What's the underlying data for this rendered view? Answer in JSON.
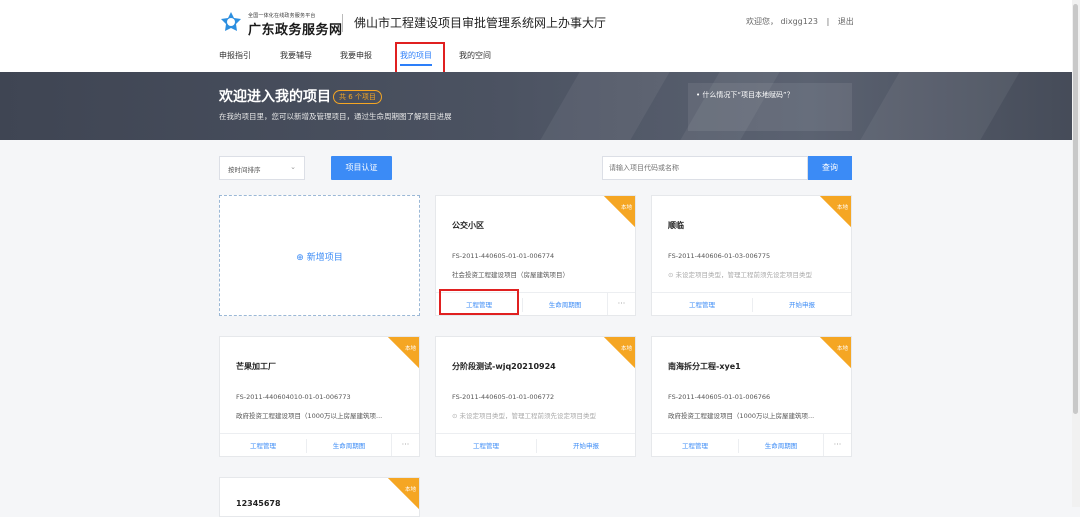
{
  "header": {
    "brand_small": "全国一体化在线政务服务平台",
    "brand_big": "广东政务服务网",
    "site_title": "佛山市工程建设项目审批管理系统网上办事大厅",
    "welcome": "欢迎您，  dixgg123",
    "separator": "|",
    "logout": "退出"
  },
  "nav": {
    "items": [
      {
        "label": "申报指引"
      },
      {
        "label": "我要辅导"
      },
      {
        "label": "我要申报"
      },
      {
        "label": "我的项目"
      },
      {
        "label": "我的空间"
      }
    ]
  },
  "banner": {
    "title": "欢迎进入我的项目",
    "badge": "共 6 个项目",
    "subtitle": "在我的项目里，您可以新增及管理项目，通过生命周期图了解项目进展",
    "help": "• 什么情况下“项目本地赋码”？"
  },
  "toolbar": {
    "sort_label": "按时间排序",
    "auth_button": "项目认证",
    "search_placeholder": "请输入项目代码或名称",
    "search_button": "查询"
  },
  "new_project": {
    "label": "⊕ 新增项目"
  },
  "cards": [
    {
      "corner": "本地",
      "title": "公交小区",
      "code": "FS-2011-440605-01-01-006774",
      "type": "社会投资工程建设项目（房屋建筑项目）",
      "btn1": "工程管理",
      "btn2": "生命周期图",
      "more": "···"
    },
    {
      "corner": "本地",
      "title": "顺临",
      "code": "FS-2011-440606-01-03-006775",
      "type": "⊙ 未设定项目类型，管理工程前须先设定项目类型",
      "btn1": "工程管理",
      "btn2": "开始申报"
    },
    {
      "corner": "本地",
      "title": "芒果加工厂",
      "code": "FS-2011-440604010-01-01-006773",
      "type": "政府投资工程建设项目（1000万以上房屋建筑项...",
      "btn1": "工程管理",
      "btn2": "生命周期图",
      "more": "···"
    },
    {
      "corner": "本地",
      "title": "分阶段测试-wjq20210924",
      "code": "FS-2011-440605-01-01-006772",
      "type": "⊙ 未设定项目类型，管理工程前须先设定项目类型",
      "btn1": "工程管理",
      "btn2": "开始申报"
    },
    {
      "corner": "本地",
      "title": "南海拆分工程-xye1",
      "code": "FS-2011-440605-01-01-006766",
      "type": "政府投资工程建设项目（1000万以上房屋建筑项...",
      "btn1": "工程管理",
      "btn2": "生命周期图",
      "more": "···"
    },
    {
      "corner": "本地",
      "title": "12345678"
    }
  ],
  "colors": {
    "accent": "#3b8bf6",
    "corner": "#f5a623",
    "highlight": "#e02020"
  }
}
